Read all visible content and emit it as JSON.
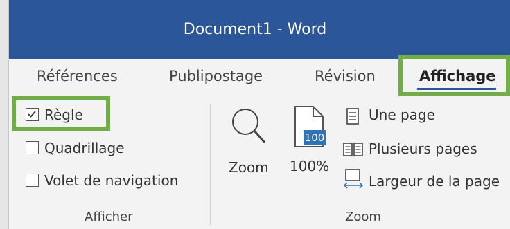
{
  "window": {
    "title": "Document1  -  Word"
  },
  "tabs": [
    {
      "label": "Références"
    },
    {
      "label": "Publipostage"
    },
    {
      "label": "Révision"
    },
    {
      "label": "Affichage"
    }
  ],
  "show_group": {
    "label": "Afficher",
    "items": [
      {
        "label": "Règle",
        "checked": true
      },
      {
        "label": "Quadrillage",
        "checked": false
      },
      {
        "label": "Volet de navigation",
        "checked": false
      }
    ]
  },
  "zoom_group": {
    "label": "Zoom",
    "zoom_label": "Zoom",
    "zoom100_label": "100%",
    "zoom100_badge": "100",
    "one_page": "Une page",
    "multiple_pages": "Plusieurs pages",
    "page_width": "Largeur de la page"
  },
  "colors": {
    "titlebar": "#2b579a",
    "highlight": "#70ad47",
    "accent_blue": "#2e75b6"
  }
}
